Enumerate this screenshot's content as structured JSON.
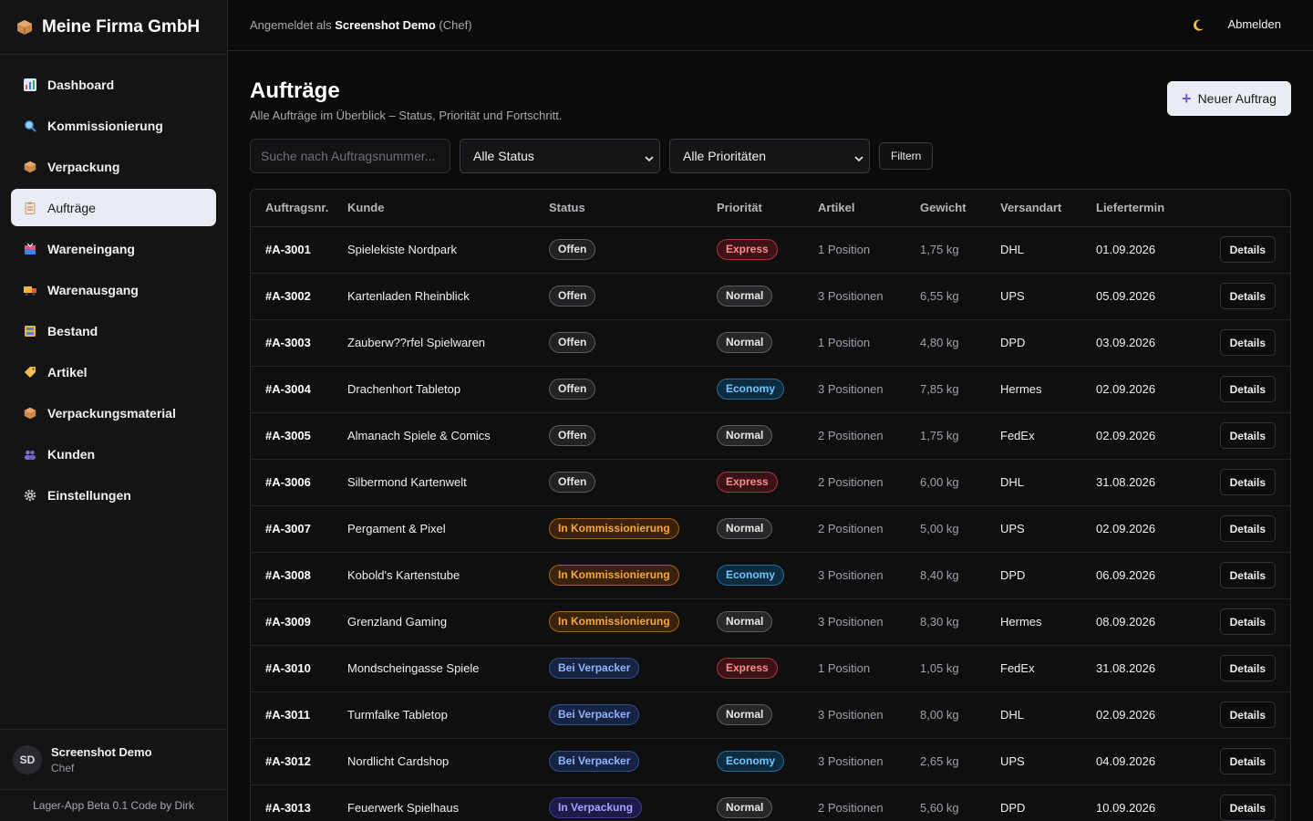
{
  "brand": {
    "title": "Meine Firma GmbH",
    "icon": "package-icon"
  },
  "sidebar": {
    "items": [
      {
        "label": "Dashboard",
        "icon": "chart-icon",
        "active": false
      },
      {
        "label": "Kommissionierung",
        "icon": "magnifier-icon",
        "active": false
      },
      {
        "label": "Verpackung",
        "icon": "package-icon",
        "active": false
      },
      {
        "label": "Aufträge",
        "icon": "clipboard-icon",
        "active": true
      },
      {
        "label": "Wareneingang",
        "icon": "inbox-icon",
        "active": false
      },
      {
        "label": "Warenausgang",
        "icon": "truck-icon",
        "active": false
      },
      {
        "label": "Bestand",
        "icon": "cabinet-icon",
        "active": false
      },
      {
        "label": "Artikel",
        "icon": "tag-icon",
        "active": false
      },
      {
        "label": "Verpackungsmaterial",
        "icon": "package-icon",
        "active": false
      },
      {
        "label": "Kunden",
        "icon": "users-icon",
        "active": false
      },
      {
        "label": "Einstellungen",
        "icon": "gear-icon",
        "active": false
      }
    ],
    "user": {
      "initials": "SD",
      "name": "Screenshot Demo",
      "role": "Chef"
    },
    "footer": "Lager-App Beta 0.1 Code by Dirk"
  },
  "topbar": {
    "prefix": "Angemeldet als",
    "user": "Screenshot Demo",
    "role": "(Chef)",
    "logout": "Abmelden"
  },
  "page": {
    "title": "Aufträge",
    "subtitle": "Alle Aufträge im Überblick – Status, Priorität und Fortschritt.",
    "new_button": "Neuer Auftrag"
  },
  "filters": {
    "search_placeholder": "Suche nach Auftragsnummer...",
    "status_value": "Alle Status",
    "priority_value": "Alle Prioritäten",
    "filter_button": "Filtern"
  },
  "table": {
    "headers": [
      "Auftragsnr.",
      "Kunde",
      "Status",
      "Priorität",
      "Artikel",
      "Gewicht",
      "Versandart",
      "Liefertermin",
      ""
    ],
    "details_label": "Details",
    "rows": [
      {
        "id": "#A-3001",
        "customer": "Spielekiste Nordpark",
        "status": "Offen",
        "status_key": "offen",
        "priority": "Express",
        "priority_key": "express",
        "items": "1 Position",
        "weight": "1,75 kg",
        "shipping": "DHL",
        "date": "01.09.2026"
      },
      {
        "id": "#A-3002",
        "customer": "Kartenladen Rheinblick",
        "status": "Offen",
        "status_key": "offen",
        "priority": "Normal",
        "priority_key": "normal",
        "items": "3 Positionen",
        "weight": "6,55 kg",
        "shipping": "UPS",
        "date": "05.09.2026"
      },
      {
        "id": "#A-3003",
        "customer": "Zauberw??rfel Spielwaren",
        "status": "Offen",
        "status_key": "offen",
        "priority": "Normal",
        "priority_key": "normal",
        "items": "1 Position",
        "weight": "4,80 kg",
        "shipping": "DPD",
        "date": "03.09.2026"
      },
      {
        "id": "#A-3004",
        "customer": "Drachenhort Tabletop",
        "status": "Offen",
        "status_key": "offen",
        "priority": "Economy",
        "priority_key": "economy",
        "items": "3 Positionen",
        "weight": "7,85 kg",
        "shipping": "Hermes",
        "date": "02.09.2026"
      },
      {
        "id": "#A-3005",
        "customer": "Almanach Spiele & Comics",
        "status": "Offen",
        "status_key": "offen",
        "priority": "Normal",
        "priority_key": "normal",
        "items": "2 Positionen",
        "weight": "1,75 kg",
        "shipping": "FedEx",
        "date": "02.09.2026"
      },
      {
        "id": "#A-3006",
        "customer": "Silbermond Kartenwelt",
        "status": "Offen",
        "status_key": "offen",
        "priority": "Express",
        "priority_key": "express",
        "items": "2 Positionen",
        "weight": "6,00 kg",
        "shipping": "DHL",
        "date": "31.08.2026"
      },
      {
        "id": "#A-3007",
        "customer": "Pergament & Pixel",
        "status": "In Kommissionierung",
        "status_key": "komm",
        "priority": "Normal",
        "priority_key": "normal",
        "items": "2 Positionen",
        "weight": "5,00 kg",
        "shipping": "UPS",
        "date": "02.09.2026"
      },
      {
        "id": "#A-3008",
        "customer": "Kobold's Kartenstube",
        "status": "In Kommissionierung",
        "status_key": "komm",
        "priority": "Economy",
        "priority_key": "economy",
        "items": "3 Positionen",
        "weight": "8,40 kg",
        "shipping": "DPD",
        "date": "06.09.2026"
      },
      {
        "id": "#A-3009",
        "customer": "Grenzland Gaming",
        "status": "In Kommissionierung",
        "status_key": "komm",
        "priority": "Normal",
        "priority_key": "normal",
        "items": "3 Positionen",
        "weight": "8,30 kg",
        "shipping": "Hermes",
        "date": "08.09.2026"
      },
      {
        "id": "#A-3010",
        "customer": "Mondscheingasse Spiele",
        "status": "Bei Verpacker",
        "status_key": "verpacker",
        "priority": "Express",
        "priority_key": "express",
        "items": "1 Position",
        "weight": "1,05 kg",
        "shipping": "FedEx",
        "date": "31.08.2026"
      },
      {
        "id": "#A-3011",
        "customer": "Turmfalke Tabletop",
        "status": "Bei Verpacker",
        "status_key": "verpacker",
        "priority": "Normal",
        "priority_key": "normal",
        "items": "3 Positionen",
        "weight": "8,00 kg",
        "shipping": "DHL",
        "date": "02.09.2026"
      },
      {
        "id": "#A-3012",
        "customer": "Nordlicht Cardshop",
        "status": "Bei Verpacker",
        "status_key": "verpacker",
        "priority": "Economy",
        "priority_key": "economy",
        "items": "3 Positionen",
        "weight": "2,65 kg",
        "shipping": "UPS",
        "date": "04.09.2026"
      },
      {
        "id": "#A-3013",
        "customer": "Feuerwerk Spielhaus",
        "status": "In Verpackung",
        "status_key": "verpackung",
        "priority": "Normal",
        "priority_key": "normal",
        "items": "2 Positionen",
        "weight": "5,60 kg",
        "shipping": "DPD",
        "date": "10.09.2026"
      }
    ]
  },
  "colors": {
    "accent_plus": "#6b5cd6",
    "active_nav_bg": "#e9ecf3",
    "status_komm": "#f5a742",
    "status_verpacker": "#8fb4ff",
    "priority_express": "#ff8a8a",
    "priority_economy": "#6ec6ff"
  }
}
